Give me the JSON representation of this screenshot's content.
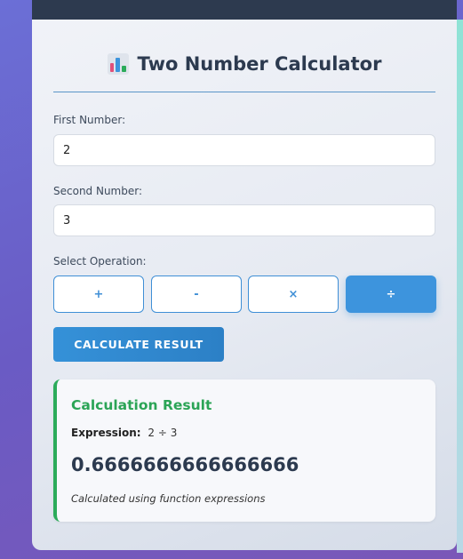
{
  "title": "Two Number Calculator",
  "title_icon": "bar-chart-icon",
  "first": {
    "label": "First Number:",
    "value": "2"
  },
  "second": {
    "label": "Second Number:",
    "value": "3"
  },
  "operation": {
    "label": "Select Operation:",
    "options": [
      "+",
      "-",
      "×",
      "÷"
    ],
    "selected": "÷"
  },
  "calculate_label": "CALCULATE RESULT",
  "result": {
    "title": "Calculation Result",
    "expression_label": "Expression:",
    "expression": "2 ÷ 3",
    "value": "0.6666666666666666",
    "note": "Calculated using function expressions"
  },
  "colors": {
    "accent": "#3d94dd",
    "success": "#2ba456",
    "header": "#2d3a4f"
  }
}
